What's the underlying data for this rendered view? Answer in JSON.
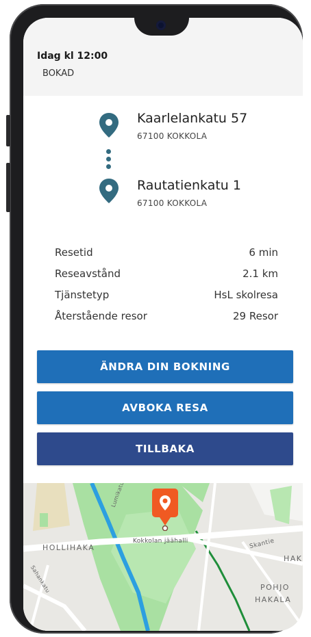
{
  "header": {
    "date": "Idag  kl 12:00",
    "status": "BOKAD"
  },
  "route": {
    "from": {
      "street": "Kaarlelankatu  57",
      "postal": "67100  KOKKOLA",
      "icon": "map-pin-icon"
    },
    "to": {
      "street": "Rautatienkatu  1",
      "postal": "67100  KOKKOLA",
      "icon": "map-pin-icon"
    }
  },
  "details": [
    {
      "label": "Resetid",
      "value": "6 min"
    },
    {
      "label": "Reseavstånd",
      "value": "2.1 km"
    },
    {
      "label": "Tjänstetyp",
      "value": "HsL skolresa"
    },
    {
      "label": "Återstående resor",
      "value": "29 Resor"
    }
  ],
  "buttons": {
    "change": "ÄNDRA DIN BOKNING",
    "cancel": "AVBOKA RESA",
    "back": "TILLBAKA"
  },
  "map": {
    "labels": {
      "hollihaka": "HOLLIHAKA",
      "place": "Kokkolan jäähalli",
      "skantie": "Skantie",
      "hak": "HAK",
      "pohjo": "POHJO",
      "hakala": "HAKALA",
      "street_left": "Sahankatu",
      "street_top": "Lumikatu"
    },
    "marker_icon": "location-marker-icon"
  },
  "colors": {
    "primary_button": "#1f6fb8",
    "secondary_button": "#2e4a8c",
    "pin": "#336b80",
    "marker": "#f05a22"
  }
}
